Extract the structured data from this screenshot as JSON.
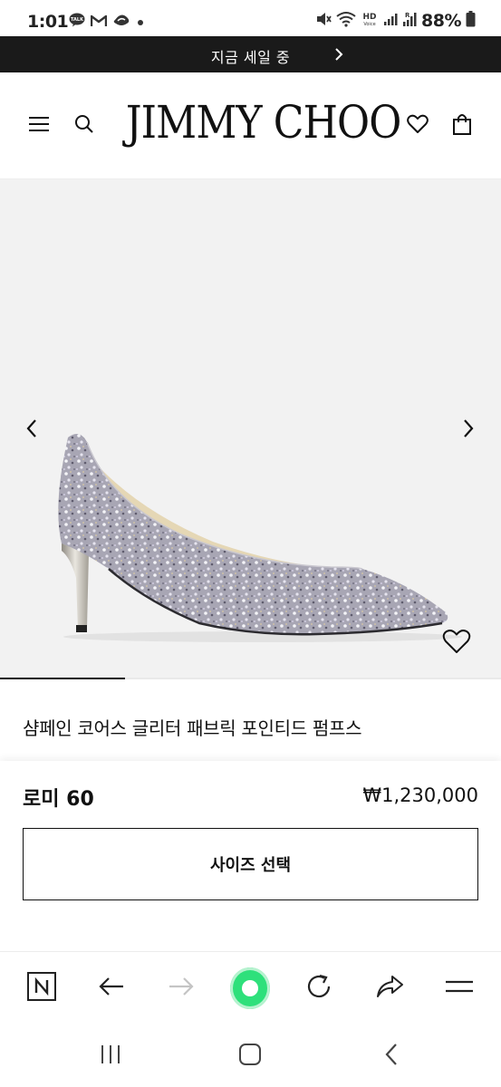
{
  "status_bar": {
    "time": "1:01",
    "battery": "88%",
    "left_icons": [
      "talk-icon",
      "gmail-icon",
      "cloud-icon",
      "dot-icon"
    ],
    "right_icons": [
      "mute-icon",
      "wifi-icon",
      "hd-voice-icon",
      "signal-icon",
      "signal-roaming-icon",
      "battery-icon"
    ]
  },
  "promo": {
    "text": "지금 세일 중"
  },
  "header": {
    "logo": "JIMMY CHOO",
    "icons": [
      "menu-icon",
      "search-icon",
      "heart-icon",
      "bag-icon"
    ]
  },
  "product": {
    "name": "샴페인 코어스 글리터 패브릭 포인티드 펌프스",
    "collection": "로미 60",
    "price": "₩1,230,000",
    "size_button": "사이즈 선택",
    "gallery_progress": 0.25
  },
  "browser_toolbar": {
    "icons": [
      "naver-n-icon",
      "back-arrow-icon",
      "forward-arrow-icon",
      "home-green-icon",
      "refresh-icon",
      "share-icon",
      "menu-lines-icon"
    ]
  },
  "nav_bar": {
    "icons": [
      "recents-icon",
      "home-icon",
      "back-icon"
    ]
  },
  "colors": {
    "banner_bg": "#1a1a1a",
    "accent_green": "#2ee07b",
    "gallery_bg": "#f2f2f2"
  }
}
